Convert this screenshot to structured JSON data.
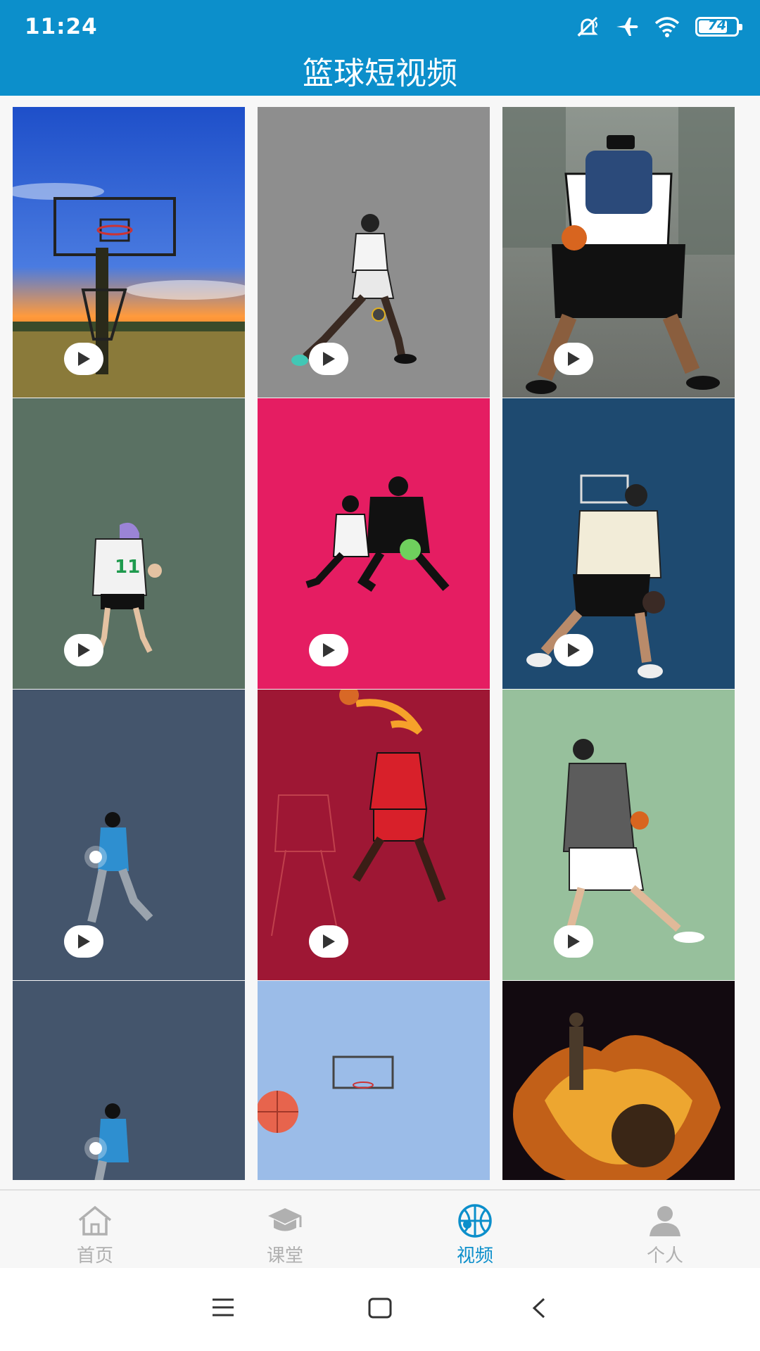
{
  "status_bar": {
    "time": "11:24",
    "battery_level": "74",
    "icons": [
      "mute-icon",
      "airplane-icon",
      "wifi-icon",
      "battery-icon"
    ]
  },
  "app_bar": {
    "title": "篮球短视频"
  },
  "videos": [
    {
      "id": 1,
      "scene": "hoop-sunset",
      "bg": "#2d57c4"
    },
    {
      "id": 2,
      "scene": "player-white-jersey",
      "bg": "#8e8e8e"
    },
    {
      "id": 3,
      "scene": "player-backpack-street",
      "bg": "#7a7f7a"
    },
    {
      "id": 4,
      "scene": "girl-jersey-11",
      "bg": "#5a7163"
    },
    {
      "id": 5,
      "scene": "two-players-defense",
      "bg": "#e51d62"
    },
    {
      "id": 6,
      "scene": "hoodie-player-hoop",
      "bg": "#1e4a70"
    },
    {
      "id": 7,
      "scene": "blue-jacket-player",
      "bg": "#44556c"
    },
    {
      "id": 8,
      "scene": "dunk-red-jersey-23",
      "bg": "#9e1734"
    },
    {
      "id": 9,
      "scene": "grey-hoodie-player",
      "bg": "#97c09c"
    },
    {
      "id": 10,
      "scene": "blue-jacket-player-2",
      "bg": "#44556c"
    },
    {
      "id": 11,
      "scene": "ball-and-hoop",
      "bg": "#9bbce8"
    },
    {
      "id": 12,
      "scene": "fire-player",
      "bg": "#120a10"
    }
  ],
  "bottom_nav": {
    "items": [
      {
        "label": "首页",
        "icon": "home-icon",
        "active": false
      },
      {
        "label": "课堂",
        "icon": "graduation-cap-icon",
        "active": false
      },
      {
        "label": "视频",
        "icon": "basketball-icon",
        "active": true
      },
      {
        "label": "个人",
        "icon": "person-icon",
        "active": false
      }
    ]
  },
  "system_nav": [
    "menu-icon",
    "home-square-icon",
    "back-icon"
  ],
  "colors": {
    "primary": "#0c8fcb",
    "inactive": "#b0b0b0"
  }
}
